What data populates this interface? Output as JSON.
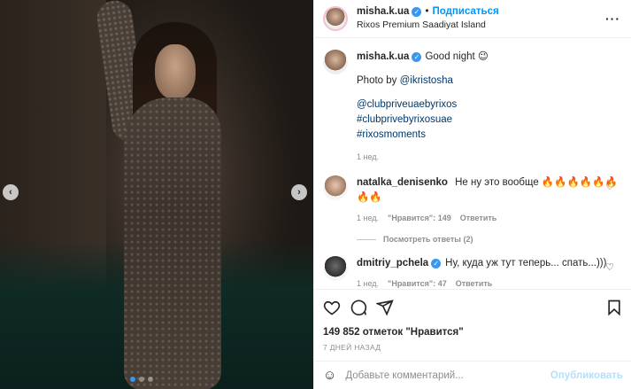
{
  "post": {
    "location": "Rixos Premium Saadiyat Island",
    "follow_label": "Подписаться",
    "separator": "•",
    "username": "misha.k.ua",
    "caption": {
      "text": "Good night 😉",
      "photo_by": "Photo by",
      "photo_by_handle": "@ikristosha",
      "tags": [
        "@clubpriveuaebyrixos",
        "#clubprivebyrixosuae",
        "#rixosmoments"
      ],
      "time": "1 нед."
    }
  },
  "comments": [
    {
      "username": "natalka_denisenko",
      "text": "Не ну это вообще 🔥🔥🔥🔥🔥🔥🔥🔥",
      "time": "1 нед.",
      "likes": "\"Нравится\": 149",
      "reply": "Ответить",
      "view_replies": "Посмотреть ответы (2)"
    },
    {
      "username": "dmitriy_pchela",
      "text": "Ну, куда уж тут теперь... спать...)))",
      "time": "1 нед.",
      "likes": "\"Нравится\": 47",
      "reply": "Ответить"
    }
  ],
  "actions": {
    "likes_count": "149 852 отметок \"Нравится\"",
    "posted": "7 ДНЕЙ НАЗАД"
  },
  "add_comment": {
    "placeholder": "Добавьте комментарий...",
    "publish_label": "Опубликовать"
  },
  "icons": {
    "more": "more-options-icon",
    "like": "heart-icon",
    "comment": "comment-icon",
    "share": "share-icon",
    "save": "bookmark-icon",
    "emoji": "emoji-icon"
  },
  "colors": {
    "accent": "#0095f6",
    "verified": "#3897f0",
    "link": "#00376b",
    "muted": "#8e8e8e"
  }
}
